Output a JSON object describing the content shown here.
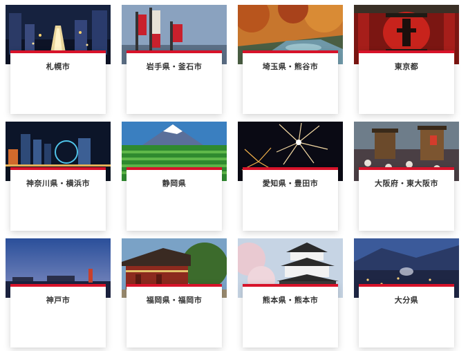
{
  "cities": [
    {
      "label": "札幌市",
      "photo": "city-night-avenue"
    },
    {
      "label": "岩手県・釜石市",
      "photo": "festival-banners"
    },
    {
      "label": "埼玉県・熊谷市",
      "photo": "autumn-gorge"
    },
    {
      "label": "東京都",
      "photo": "temple-lantern"
    },
    {
      "label": "神奈川県・横浜市",
      "photo": "harbor-skyline-night"
    },
    {
      "label": "静岡県",
      "photo": "mount-fuji-tea-fields"
    },
    {
      "label": "愛知県・豊田市",
      "photo": "fireworks"
    },
    {
      "label": "大阪府・東大阪市",
      "photo": "danjiri-festival"
    },
    {
      "label": "神戸市",
      "photo": "port-dusk"
    },
    {
      "label": "福岡県・福岡市",
      "photo": "shrine-hall"
    },
    {
      "label": "熊本県・熊本市",
      "photo": "castle-cherry-blossoms"
    },
    {
      "label": "大分県",
      "photo": "hot-spring-town-night"
    }
  ],
  "accent_color": "#d7132a"
}
